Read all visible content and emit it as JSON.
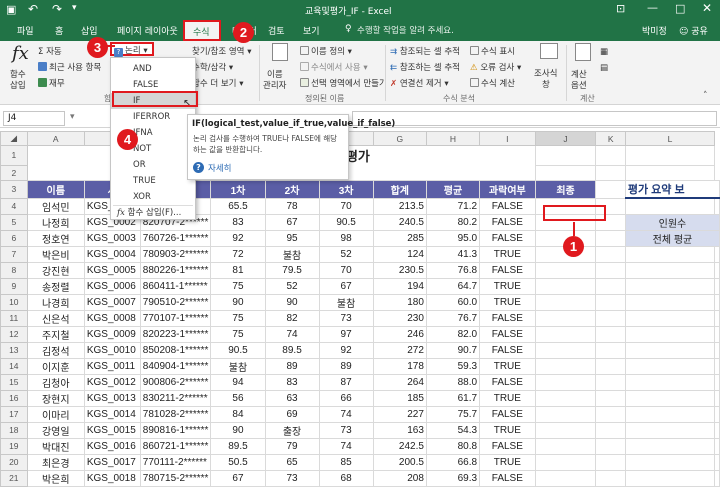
{
  "titlebar": {
    "title": "교육및평가_IF - Excel",
    "user": "박미정",
    "share": "공유",
    "tellme": "수행할 작업을 알려 주세요."
  },
  "tabs": [
    "파일",
    "홈",
    "삽입",
    "페이지 레이아웃",
    "수식",
    "데이터",
    "검토",
    "보기"
  ],
  "ribbon": {
    "fx_label_1": "함수",
    "fx_label_2": "삽입",
    "autosum": "자동",
    "recent": "최근 사용 항목",
    "finance": "재무",
    "logic": "논리",
    "lookup": "찾기/참조 영역",
    "math": "수학/삼각",
    "more": "함수 더 보기",
    "name_mgr_1": "이름",
    "name_mgr_2": "관리자",
    "define_name": "이름 정의",
    "use_in_formula": "수식에서 사용",
    "create_sel": "선택 영역에서 만들기",
    "group_names": "정의된 이름",
    "trace_prec": "참조되는 셀 추적",
    "trace_dep": "참조하는 셀 추적",
    "remove_arrows": "연결선 제거",
    "show_formulas": "수식 표시",
    "error_check": "오류 검사",
    "evaluate": "수식 계산",
    "group_audit": "수식 분석",
    "watch_1": "조사식",
    "watch_2": "창",
    "calc_opt_1": "계산",
    "calc_opt_2": "옵션",
    "group_calc": "계산",
    "group_lib": "함수 라이브러리"
  },
  "formula_bar": {
    "name_box": "J4",
    "value": ""
  },
  "dropdown": {
    "items": [
      "AND",
      "FALSE",
      "IF",
      "IFERROR",
      "IFNA",
      "NOT",
      "OR",
      "TRUE",
      "XOR"
    ],
    "insert_function": "함수 삽입(F)..."
  },
  "tooltip": {
    "signature": "IF(logical_test,value_if_true,value_if_false)",
    "desc": "논리 검사를 수행하여 TRUE나 FALSE에 해당하는 값을 반환합니다.",
    "more": "자세히"
  },
  "sheet": {
    "columns": [
      "A",
      "B",
      "C",
      "D",
      "E",
      "F",
      "G",
      "H",
      "I",
      "J",
      "K",
      "L"
    ],
    "title": "및 평가",
    "headers": [
      "이름",
      "사번",
      "주민번호",
      "1차",
      "2차",
      "3차",
      "합계",
      "평균",
      "과락여부",
      "최종"
    ],
    "header_visible": [
      "이름",
      "사",
      "",
      "1차",
      "2차",
      "3차",
      "합계",
      "평균",
      "과락여부",
      "최종"
    ],
    "rows": [
      [
        "임석민",
        "KGS_0001",
        "******",
        "65.5",
        "78",
        "70",
        "213.5",
        "71.2",
        "FALSE",
        ""
      ],
      [
        "나정희",
        "KGS_0002",
        "820707-2******",
        "83",
        "67",
        "90.5",
        "240.5",
        "80.2",
        "FALSE",
        ""
      ],
      [
        "정호연",
        "KGS_0003",
        "760726-1******",
        "92",
        "95",
        "98",
        "285",
        "95.0",
        "FALSE",
        ""
      ],
      [
        "박은비",
        "KGS_0004",
        "780903-2******",
        "72",
        "불참",
        "52",
        "124",
        "41.3",
        "TRUE",
        ""
      ],
      [
        "강진현",
        "KGS_0005",
        "880226-1******",
        "81",
        "79.5",
        "70",
        "230.5",
        "76.8",
        "FALSE",
        ""
      ],
      [
        "송정렬",
        "KGS_0006",
        "860411-1******",
        "75",
        "52",
        "67",
        "194",
        "64.7",
        "TRUE",
        ""
      ],
      [
        "나경희",
        "KGS_0007",
        "790510-2******",
        "90",
        "90",
        "불참",
        "180",
        "60.0",
        "TRUE",
        ""
      ],
      [
        "신은석",
        "KGS_0008",
        "770107-1******",
        "75",
        "82",
        "73",
        "230",
        "76.7",
        "FALSE",
        ""
      ],
      [
        "주지철",
        "KGS_0009",
        "820223-1******",
        "75",
        "74",
        "97",
        "246",
        "82.0",
        "FALSE",
        ""
      ],
      [
        "김정석",
        "KGS_0010",
        "850208-1******",
        "90.5",
        "89.5",
        "92",
        "272",
        "90.7",
        "FALSE",
        ""
      ],
      [
        "이지훈",
        "KGS_0011",
        "840904-1******",
        "불참",
        "89",
        "89",
        "178",
        "59.3",
        "TRUE",
        ""
      ],
      [
        "김청아",
        "KGS_0012",
        "900806-2******",
        "94",
        "83",
        "87",
        "264",
        "88.0",
        "FALSE",
        ""
      ],
      [
        "장현지",
        "KGS_0013",
        "830211-2******",
        "56",
        "63",
        "66",
        "185",
        "61.7",
        "TRUE",
        ""
      ],
      [
        "이마리",
        "KGS_0014",
        "781028-2******",
        "84",
        "69",
        "74",
        "227",
        "75.7",
        "FALSE",
        ""
      ],
      [
        "강영일",
        "KGS_0015",
        "890816-1******",
        "90",
        "출장",
        "73",
        "163",
        "54.3",
        "TRUE",
        ""
      ],
      [
        "박대진",
        "KGS_0016",
        "860721-1******",
        "89.5",
        "79",
        "74",
        "242.5",
        "80.8",
        "FALSE",
        ""
      ],
      [
        "최은경",
        "KGS_0017",
        "770111-2******",
        "50.5",
        "65",
        "85",
        "200.5",
        "66.8",
        "TRUE",
        ""
      ],
      [
        "박은희",
        "KGS_0018",
        "780715-2******",
        "67",
        "73",
        "68",
        "208",
        "69.3",
        "FALSE",
        ""
      ]
    ],
    "summary_title": "평가 요약 보",
    "summary_labels": [
      "인원수",
      "전체 평균"
    ]
  },
  "annotations": [
    "1",
    "2",
    "3",
    "4"
  ],
  "colors": {
    "brand": "#217346",
    "header": "#5b5ea6",
    "badge": "#e0191e",
    "summary": "#d6dcee"
  }
}
